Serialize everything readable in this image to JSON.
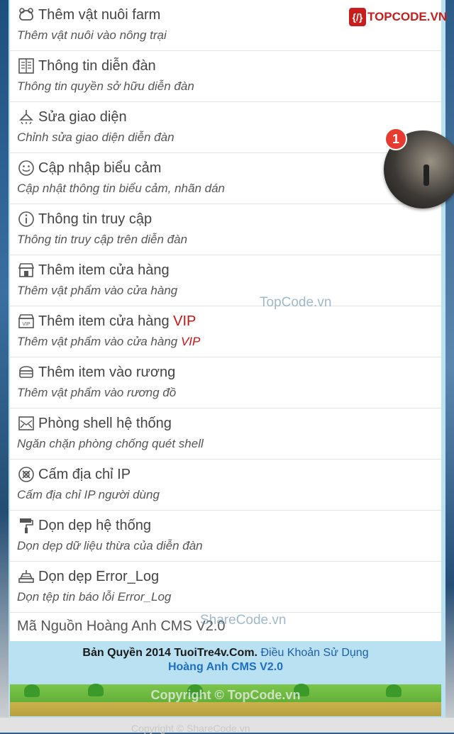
{
  "menu": [
    {
      "icon": "farm-animal-icon",
      "title": "Thêm vật nuôi farm",
      "desc": "Thêm vật nuôi vào nông trại"
    },
    {
      "icon": "forum-info-icon",
      "title": "Thông tin diễn đàn",
      "desc": "Thông tin quyền sở hữu diễn đàn"
    },
    {
      "icon": "lamp-icon",
      "title": "Sửa giao diện",
      "desc": "Chỉnh sửa giao diện diễn đàn"
    },
    {
      "icon": "smiley-icon",
      "title": "Cập nhập biểu cảm",
      "desc": "Cập nhật thông tin biểu cảm, nhãn dán"
    },
    {
      "icon": "info-circle-icon",
      "title": "Thông tin truy cập",
      "desc": "Thông tin truy cập trên diễn đàn"
    },
    {
      "icon": "shop-icon",
      "title": "Thêm item cửa hàng",
      "desc": "Thêm vật phẩm vào cửa hàng"
    },
    {
      "icon": "vip-shop-icon",
      "title": "Thêm item cửa hàng",
      "title_vip": "VIP",
      "desc": "Thêm vật phẩm vào cửa hàng",
      "desc_vip": "VIP"
    },
    {
      "icon": "chest-icon",
      "title": "Thêm item vào rương",
      "desc": "Thêm vật phẩm vào rương đồ"
    },
    {
      "icon": "shell-shield-icon",
      "title": "Phòng shell hệ thống",
      "desc": "Ngăn chặn phòng chống quét shell"
    },
    {
      "icon": "ban-ip-icon",
      "title": "Cấm địa chỉ IP",
      "desc": "Cấm địa chỉ IP người dùng"
    },
    {
      "icon": "paint-roller-icon",
      "title": "Dọn dẹp hệ thống",
      "desc": "Dọn dẹp dữ liệu thừa của diễn đàn"
    },
    {
      "icon": "error-log-icon",
      "title": "Dọn dẹp Error_Log",
      "desc": "Dọn tệp tin báo lỗi Error_Log"
    }
  ],
  "source_label": "Mã Nguồn Hoàng Anh CMS V2.0",
  "footer": {
    "copyright_prefix": "Bản Quyền 2014",
    "site": "TuoiTre4v.Com.",
    "terms": "Điều Khoản Sử Dụng",
    "product": "Hoàng Anh CMS V2.0",
    "watermark": "Copyright © TopCode.vn"
  },
  "logo": {
    "mark": "{/}",
    "text": "TOPCODE.VN"
  },
  "watermarks": {
    "center": "TopCode.vn",
    "bottom": "ShareCode.vn"
  },
  "chat_head": {
    "badge_count": "1"
  },
  "below_text": "Copyright © ShareCode.vn"
}
